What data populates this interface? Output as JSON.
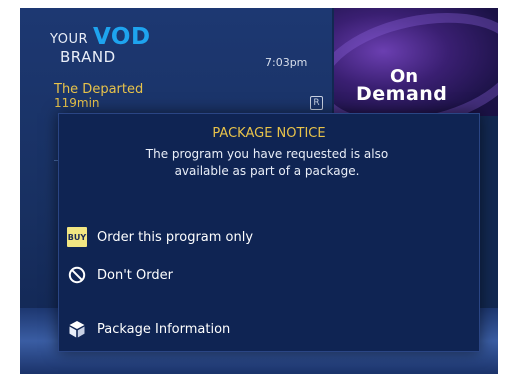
{
  "brand": {
    "your": "YOUR",
    "vod": "VOD",
    "name": "BRAND"
  },
  "clock": "7:03pm",
  "promo": {
    "line1": "On",
    "line2": "Demand"
  },
  "program": {
    "title": "The Departed",
    "duration": "119min",
    "rating_icon": "rating-icon"
  },
  "dialog": {
    "title": "PACKAGE NOTICE",
    "message": "The program you have requested is also available as part of a package.",
    "options": [
      {
        "icon": "buy-icon",
        "badge": "BUY",
        "label": "Order this program only"
      },
      {
        "icon": "no-entry-icon",
        "label": "Don't Order"
      },
      {
        "icon": "package-icon",
        "label": "Package Information"
      }
    ]
  },
  "colors": {
    "background": "#0e1f45",
    "panel": "#0f2453",
    "accent_yellow": "#e8c34a",
    "vod_blue": "#1ea4ef",
    "buy_badge": "#f2e682"
  }
}
